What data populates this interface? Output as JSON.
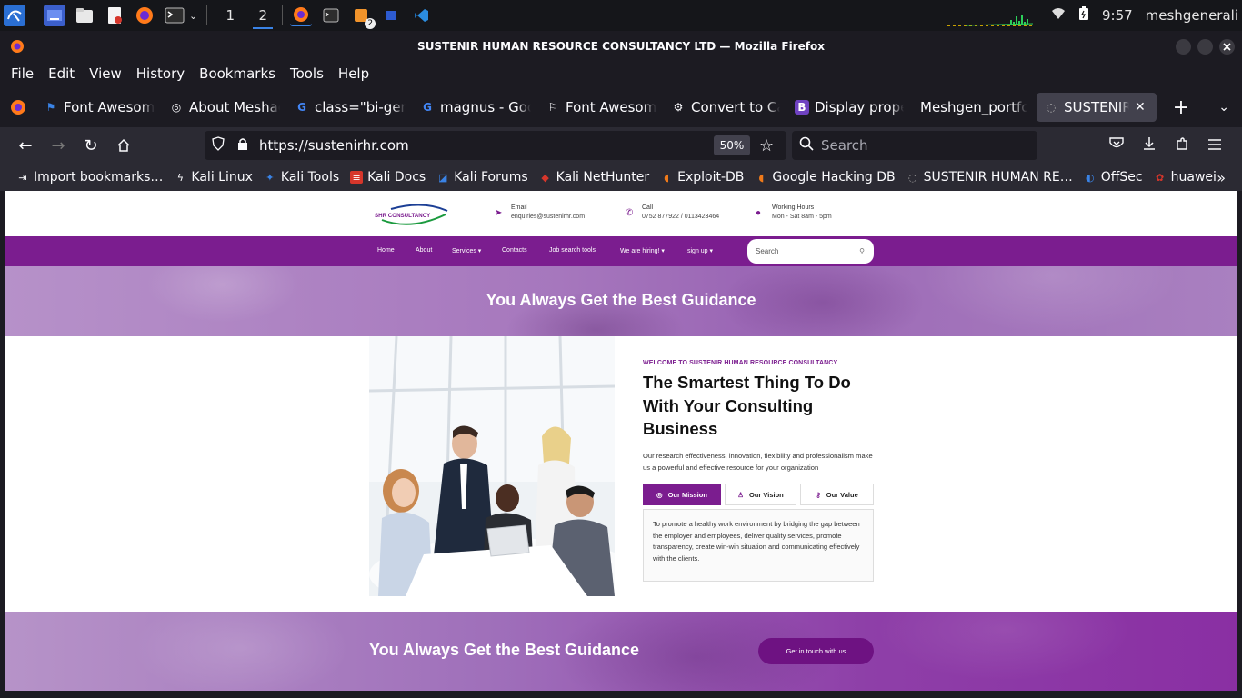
{
  "taskbar": {
    "workspaces": [
      "1",
      "2"
    ],
    "active_workspace": "2",
    "terminal_badge": "2",
    "clock": "9:57",
    "user": "meshgenerali"
  },
  "window": {
    "title": "SUSTENIR HUMAN RESOURCE CONSULTANCY LTD — Mozilla Firefox"
  },
  "menubar": [
    "File",
    "Edit",
    "View",
    "History",
    "Bookmarks",
    "Tools",
    "Help"
  ],
  "tabs": [
    {
      "label": "Font Awesome",
      "icon": "flag-icon"
    },
    {
      "label": "About Meshack",
      "icon": "globe-icon"
    },
    {
      "label": "class=\"bi-gem",
      "icon": "google-icon"
    },
    {
      "label": "magnus - Goo",
      "icon": "google-icon"
    },
    {
      "label": "Font Awesome",
      "icon": "flag-icon"
    },
    {
      "label": "Convert to Ca",
      "icon": "openai-icon"
    },
    {
      "label": "Display prope",
      "icon": "bootstrap-icon"
    },
    {
      "label": "Meshgen_portfol",
      "icon": "none"
    },
    {
      "label": "SUSTENIR H",
      "icon": "site-icon",
      "active": true
    }
  ],
  "navbar": {
    "url": "https://sustenirhr.com",
    "zoom": "50%",
    "search_placeholder": "Search"
  },
  "bookmarks": [
    "Import bookmarks…",
    "Kali Linux",
    "Kali Tools",
    "Kali Docs",
    "Kali Forums",
    "Kali NetHunter",
    "Exploit-DB",
    "Google Hacking DB",
    "SUSTENIR HUMAN RE…",
    "OffSec",
    "huawei"
  ],
  "site": {
    "logo_text": "SHR CONSULTANCY",
    "contact": {
      "email_label": "Email",
      "email_value": "enquiries@sustenirhr.com",
      "call_label": "Call",
      "call_value": "0752 877922 / 0113423464",
      "hours_label": "Working Hours",
      "hours_value": "Mon - Sat 8am - 5pm"
    },
    "nav": [
      "Home",
      "About",
      "Services ▾",
      "Contacts",
      "Job search tools",
      "We are hiring! ▾",
      "sign up ▾"
    ],
    "search_placeholder": "Search",
    "banner_top": "You Always Get the Best Guidance",
    "eyebrow": "WELCOME TO SUSTENIR HUMAN RESOURCE CONSULTANCY",
    "headline": "The Smartest Thing To Do With Your Consulting Business",
    "description": "Our research effectiveness, innovation, flexibility and professionalism make us a powerful and effective resource for your organization",
    "tab_buttons": [
      "Our Mission",
      "Our Vision",
      "Our Value"
    ],
    "mission_text": "To promote a healthy work environment by bridging the gap between the employer and employees, deliver quality services, promote transparency, create win-win situation and communicating effectively with the clients.",
    "banner_bottom": "You Always Get the Best Guidance",
    "cta": "Get in touch with us"
  },
  "colors": {
    "brand_purple": "#7b1d8f",
    "firefox_dark": "#1c1b22",
    "firefox_toolbar": "#2b2a33"
  }
}
